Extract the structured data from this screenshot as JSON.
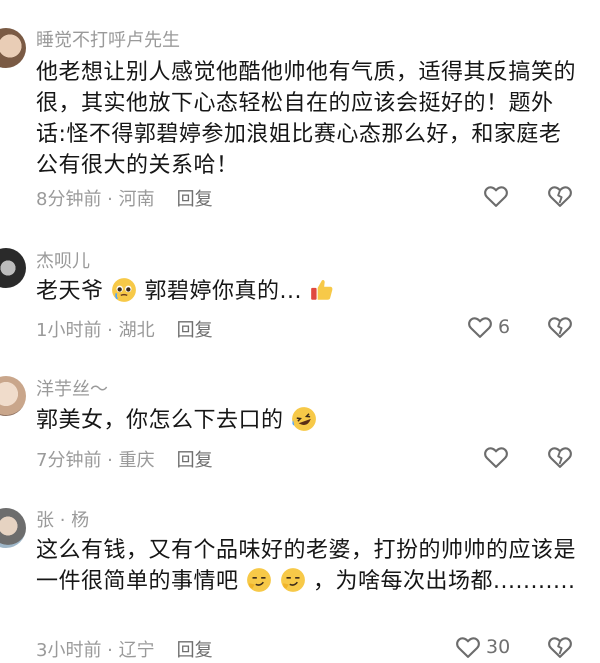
{
  "comments": [
    {
      "user": "睡觉不打呼卢先生",
      "text": "他老想让别人感觉他酷他帅他有气质，适得其反搞笑的很，其实他放下心态轻松自在的应该会挺好的！题外话:怪不得郭碧婷参加浪姐比赛心态那么好，和家庭老公有很大的关系哈！",
      "time": "8分钟前",
      "location": "河南",
      "reply": "回复",
      "likes": ""
    },
    {
      "user": "杰呗儿",
      "text_a": "老天爷 ",
      "text_b": "郭碧婷你真的...",
      "time": "1小时前",
      "location": "湖北",
      "reply": "回复",
      "likes": "6"
    },
    {
      "user": "洋芋丝～",
      "text": "郭美女，你怎么下去口的",
      "time": "7分钟前",
      "location": "重庆",
      "reply": "回复",
      "likes": ""
    },
    {
      "user": "张 · 杨",
      "text_a": "这么有钱，又有个品味好的老婆，打扮的帅帅的应该是一件很简单的事情吧",
      "text_b": "，为啥每次出场都...........",
      "time": "3小时前",
      "location": "辽宁",
      "reply": "回复",
      "likes": "30"
    }
  ],
  "separator": " · ",
  "icons": [
    "heart-outline-icon",
    "broken-heart-icon",
    "pleading-face-emoji",
    "thumbs-up-emoji",
    "rofl-emoji",
    "smirk-face-emoji"
  ]
}
